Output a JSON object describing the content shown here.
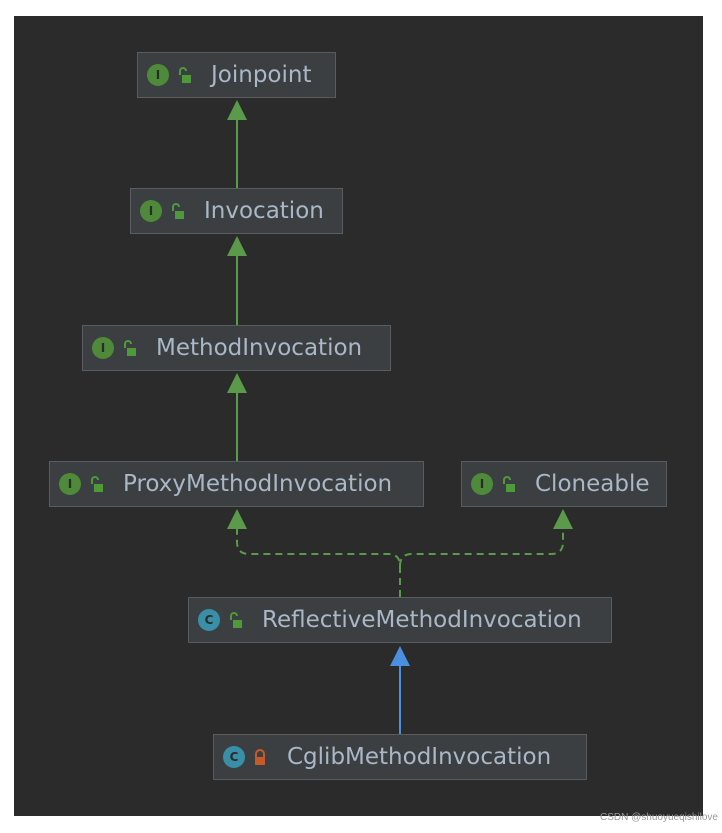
{
  "nodes": [
    {
      "id": "joinpoint",
      "name": "Joinpoint",
      "kind": "interface",
      "kind_letter": "I",
      "visibility": "public"
    },
    {
      "id": "invocation",
      "name": "Invocation",
      "kind": "interface",
      "kind_letter": "I",
      "visibility": "public"
    },
    {
      "id": "method-invocation",
      "name": "MethodInvocation",
      "kind": "interface",
      "kind_letter": "I",
      "visibility": "public"
    },
    {
      "id": "proxy-method-invocation",
      "name": "ProxyMethodInvocation",
      "kind": "interface",
      "kind_letter": "I",
      "visibility": "public"
    },
    {
      "id": "cloneable",
      "name": "Cloneable",
      "kind": "interface",
      "kind_letter": "I",
      "visibility": "public"
    },
    {
      "id": "reflective-method-invocation",
      "name": "ReflectiveMethodInvocation",
      "kind": "class",
      "kind_letter": "C",
      "visibility": "public"
    },
    {
      "id": "cglib-method-invocation",
      "name": "CglibMethodInvocation",
      "kind": "class",
      "kind_letter": "C",
      "visibility": "private"
    }
  ],
  "edges": [
    {
      "from": "Invocation",
      "to": "Joinpoint",
      "type": "extends"
    },
    {
      "from": "MethodInvocation",
      "to": "Invocation",
      "type": "extends"
    },
    {
      "from": "ProxyMethodInvocation",
      "to": "MethodInvocation",
      "type": "extends"
    },
    {
      "from": "ReflectiveMethodInvocation",
      "to": "ProxyMethodInvocation",
      "type": "implements"
    },
    {
      "from": "ReflectiveMethodInvocation",
      "to": "Cloneable",
      "type": "implements"
    },
    {
      "from": "CglibMethodInvocation",
      "to": "ReflectiveMethodInvocation",
      "type": "extends-class"
    }
  ],
  "colors": {
    "background": "#2b2b2b",
    "interface_badge": "#4e8a3a",
    "class_badge": "#3a8fa8",
    "interface_edge": "#5a9a4a",
    "class_edge": "#4a8fe0",
    "public_lock": "#4e9a3a",
    "private_lock": "#c75a2a",
    "text": "#a9b7c6"
  },
  "watermark": "CSDN @shuoyueqishilove"
}
